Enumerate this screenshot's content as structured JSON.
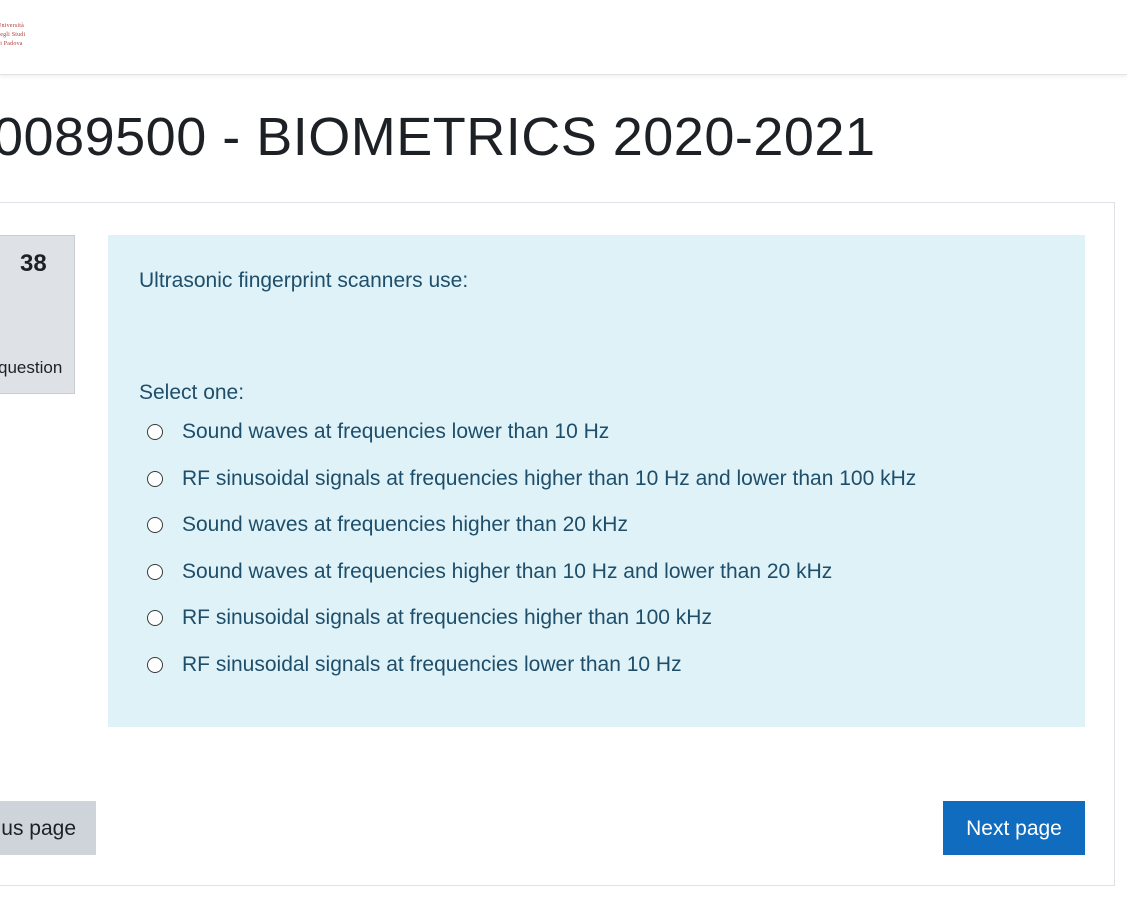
{
  "header": {
    "logo_lines": [
      "Università",
      "degli Studi",
      "di Padova"
    ]
  },
  "page": {
    "title": "0089500 - BIOMETRICS 2020-2021"
  },
  "question_info": {
    "number": "38",
    "state": "d",
    "flag_label": "question"
  },
  "question": {
    "text": "Ultrasonic fingerprint scanners use:",
    "prompt": "Select one:",
    "options": [
      "Sound waves at frequencies lower than 10 Hz",
      "RF sinusoidal signals at frequencies higher than 10 Hz and lower than 100 kHz",
      "Sound waves at frequencies higher than 20 kHz",
      "Sound waves at frequencies higher than 10 Hz and lower than 20 kHz",
      "RF sinusoidal signals at frequencies higher than 100 kHz",
      "RF sinusoidal signals at frequencies lower than 10 Hz"
    ]
  },
  "navigation": {
    "prev_label": "us page",
    "next_label": "Next page"
  },
  "colors": {
    "question_bg": "#def2f8",
    "question_text": "#1e4e6a",
    "next_button": "#0f6cbf",
    "prev_button": "#ced4da",
    "info_panel": "#dee2e6"
  }
}
